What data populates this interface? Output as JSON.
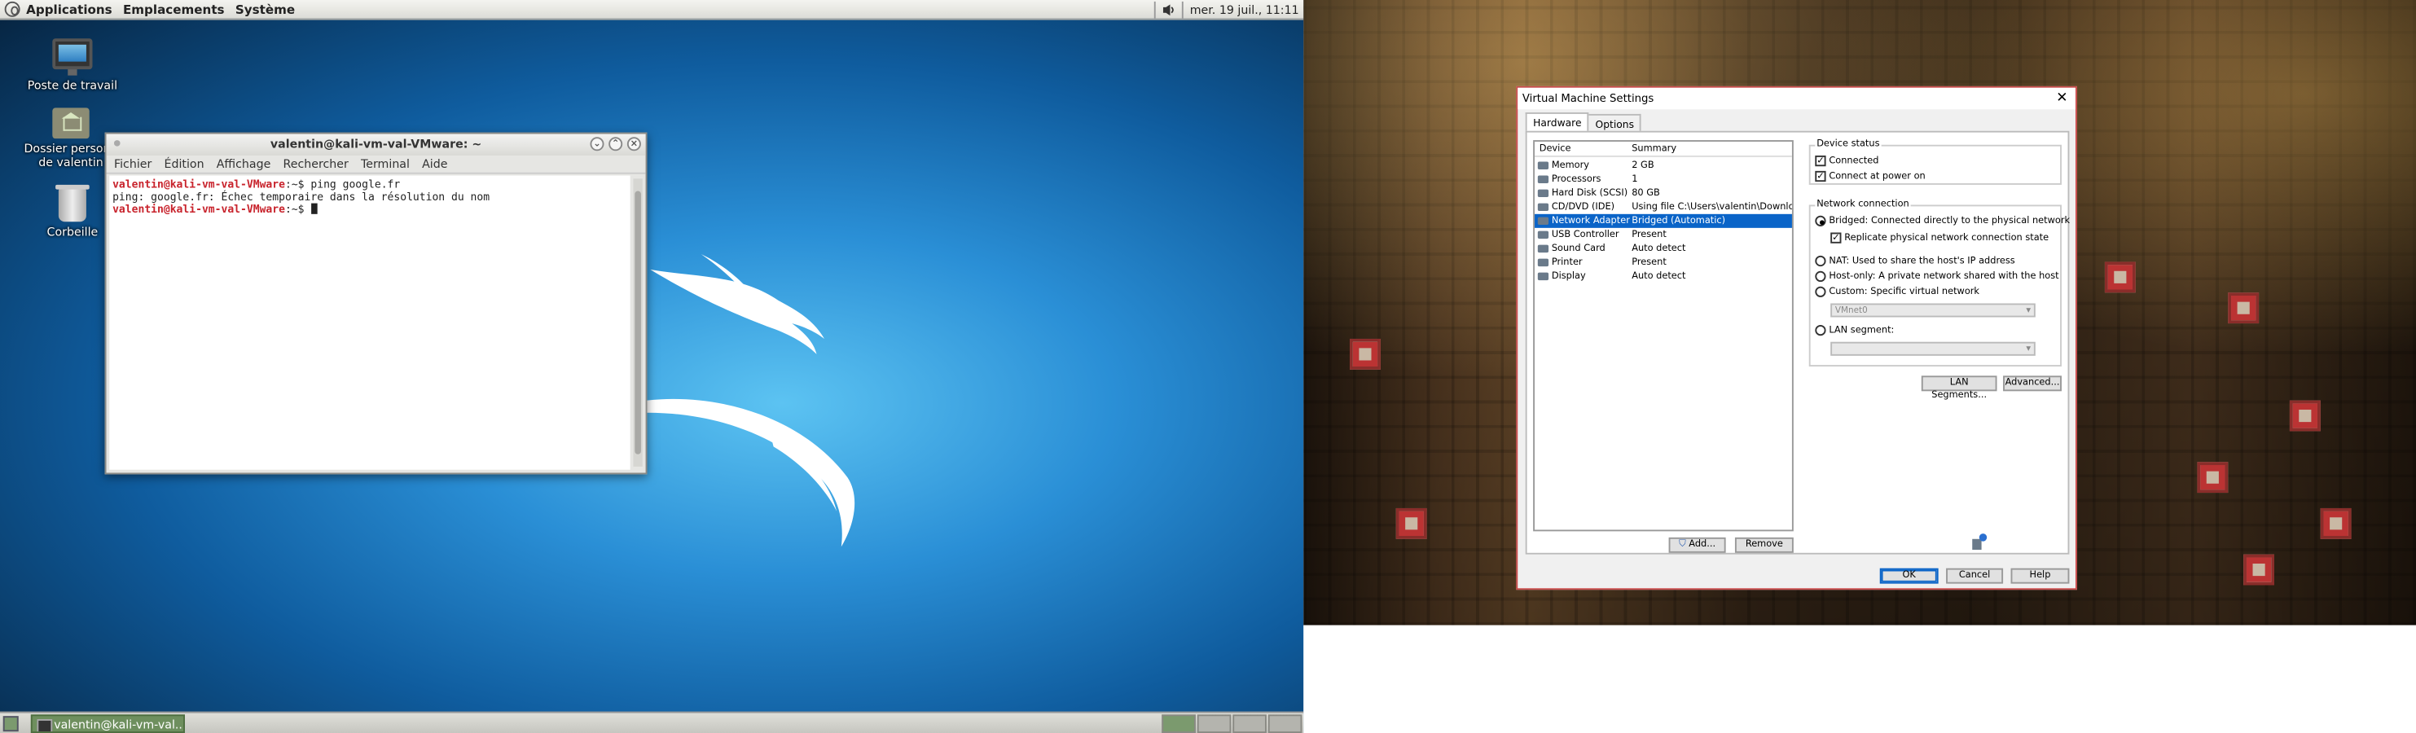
{
  "topbar": {
    "menus": [
      "Applications",
      "Emplacements",
      "Système"
    ],
    "clock": "mer. 19 juil., 11:11"
  },
  "desktop_icons": [
    {
      "label_lines": [
        "Poste de travail"
      ],
      "icon": "computer-icon"
    },
    {
      "label_lines": [
        "Dossier personn",
        "de valentin"
      ],
      "icon": "home-folder-icon"
    },
    {
      "label_lines": [
        "Corbeille"
      ],
      "icon": "trash-icon"
    }
  ],
  "terminal": {
    "title": "valentin@kali-vm-val-VMware: ~",
    "menus": [
      "Fichier",
      "Édition",
      "Affichage",
      "Rechercher",
      "Terminal",
      "Aide"
    ],
    "lines": [
      {
        "prompt": "valentin@kali-vm-val-VMware",
        "path": ":~$",
        "cmd": " ping google.fr"
      },
      {
        "prompt": "",
        "path": "",
        "cmd": "ping: google.fr: Échec temporaire dans la résolution du nom"
      },
      {
        "prompt": "valentin@kali-vm-val-VMware",
        "path": ":~$",
        "cmd": " "
      }
    ],
    "buttons": {
      "minimize": "⌄",
      "maximize": "⌃",
      "close": "×"
    }
  },
  "taskbar": {
    "task_label": "valentin@kali-vm-val..."
  },
  "vm_dialog": {
    "title": "Virtual Machine Settings",
    "close": "✕",
    "tabs": [
      "Hardware",
      "Options"
    ],
    "device_header": "Device",
    "summary_header": "Summary",
    "devices": [
      {
        "name": "Memory",
        "summary": "2 GB"
      },
      {
        "name": "Processors",
        "summary": "1"
      },
      {
        "name": "Hard Disk (SCSI)",
        "summary": "80 GB"
      },
      {
        "name": "CD/DVD (IDE)",
        "summary": "Using file C:\\Users\\valentin\\Downloa..."
      },
      {
        "name": "Network Adapter",
        "summary": "Bridged (Automatic)",
        "selected": true
      },
      {
        "name": "USB Controller",
        "summary": "Present"
      },
      {
        "name": "Sound Card",
        "summary": "Auto detect"
      },
      {
        "name": "Printer",
        "summary": "Present"
      },
      {
        "name": "Display",
        "summary": "Auto detect"
      }
    ],
    "add_button": "Add...",
    "remove_button": "Remove",
    "device_status": {
      "legend": "Device status",
      "connected": "Connected",
      "connect_power_on": "Connect at power on"
    },
    "network_connection": {
      "legend": "Network connection",
      "bridged": "Bridged: Connected directly to the physical network",
      "replicate": "Replicate physical network connection state",
      "nat": "NAT: Used to share the host's IP address",
      "hostonly": "Host-only: A private network shared with the host",
      "custom": "Custom: Specific virtual network",
      "vmnet": "VMnet0",
      "lan_segment": "LAN segment:"
    },
    "lan_segments_button": "LAN Segments...",
    "advanced_button": "Advanced...",
    "ok_button": "OK",
    "cancel_button": "Cancel",
    "help_button": "Help"
  }
}
